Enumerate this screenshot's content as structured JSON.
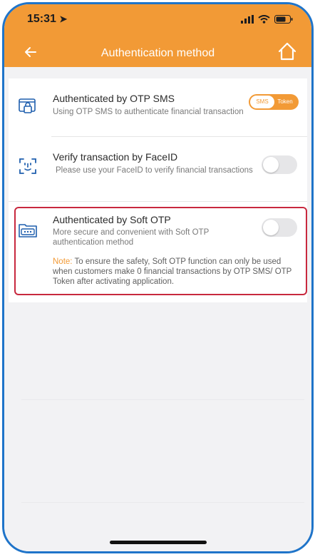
{
  "status_bar": {
    "time": "15:31"
  },
  "header": {
    "title": "Authentication method"
  },
  "items": [
    {
      "title": "Authenticated by OTP SMS",
      "description": "Using OTP SMS to authenticate financial transaction",
      "control": {
        "type": "segmented",
        "options": [
          "SMS",
          "Token"
        ],
        "selected": "SMS"
      }
    },
    {
      "title": "Verify transaction by FaceID",
      "description": "Please use your FaceID to verify financial transactions",
      "control": {
        "type": "toggle",
        "on": false
      }
    },
    {
      "title": "Authenticated by Soft OTP",
      "description": "More secure and convenient with Soft OTP authentication method",
      "note_label": "Note:",
      "note_text": "To ensure the safety, Soft OTP function can only be used when customers make 0 financial transactions by OTP SMS/ OTP Token after activating application.",
      "control": {
        "type": "toggle",
        "on": false
      }
    }
  ],
  "colors": {
    "accent": "#f29a36",
    "highlight": "#c8283e",
    "icon": "#1f5fae"
  }
}
